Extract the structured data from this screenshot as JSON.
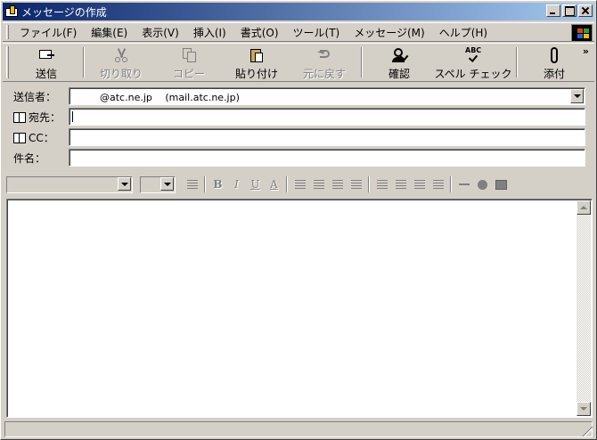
{
  "window": {
    "title": "メッセージの作成"
  },
  "menu": {
    "items": [
      {
        "label": "ファイル(F)"
      },
      {
        "label": "編集(E)"
      },
      {
        "label": "表示(V)"
      },
      {
        "label": "挿入(I)"
      },
      {
        "label": "書式(O)"
      },
      {
        "label": "ツール(T)"
      },
      {
        "label": "メッセージ(M)"
      },
      {
        "label": "ヘルプ(H)"
      }
    ]
  },
  "toolbar": {
    "send_label": "送信",
    "cut_label": "切り取り",
    "copy_label": "コピー",
    "paste_label": "貼り付け",
    "undo_label": "元に戻す",
    "check_label": "確認",
    "spell_label": "スペル チェック",
    "spell_icon_text": "ABC",
    "attach_label": "添付",
    "overflow": "»"
  },
  "fields": {
    "from_label": "送信者：",
    "from_value": "@atc.ne.jp　 (mail.atc.ne.jp)",
    "to_label": "宛先：",
    "to_value": "",
    "cc_label": "CC：",
    "cc_value": "",
    "subject_label": "件名：",
    "subject_value": ""
  },
  "format_toolbar": {
    "font_value": "",
    "size_value": "",
    "bold": "B",
    "italic": "I",
    "underline": "U",
    "font_color": "A"
  },
  "body": {
    "text": ""
  },
  "colors": {
    "titlebar_start": "#0a246a",
    "titlebar_end": "#a6caf0",
    "face": "#d4d0c8"
  }
}
